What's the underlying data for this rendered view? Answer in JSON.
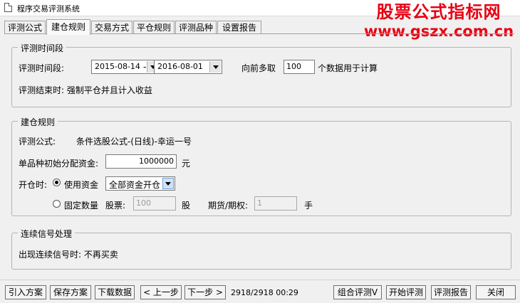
{
  "window": {
    "title": "程序交易评测系统"
  },
  "watermark": {
    "line1": "股票公式指标网",
    "line2": "www.gszx.com.cn"
  },
  "tabs": [
    {
      "label": "评测公式"
    },
    {
      "label": "建仓规则"
    },
    {
      "label": "交易方式"
    },
    {
      "label": "平仓规则"
    },
    {
      "label": "评测品种"
    },
    {
      "label": "设置报告"
    }
  ],
  "period": {
    "title": "评测时间段",
    "label": "评测时间段:",
    "start": "2015-08-14",
    "dash": "-",
    "end": "2016-08-01",
    "lookback_prefix": "向前多取",
    "lookback_value": "100",
    "lookback_suffix": "个数据用于计算",
    "end_rule": "评测结束时: 强制平仓并且计入收益"
  },
  "build": {
    "title": "建仓规则",
    "formula_label": "评测公式:",
    "formula_value": "条件选股公式-(日线)-幸运一号",
    "capital_label": "单品种初始分配资金:",
    "capital_value": "1000000",
    "capital_unit": "元",
    "open_label": "开仓时:",
    "use_capital_label": "使用资金",
    "use_capital_option": "全部资金开仓",
    "fixed_qty_label": "固定数量",
    "stock_label": "股票:",
    "stock_value": "100",
    "stock_unit": "股",
    "futures_label": "期货/期权:",
    "futures_value": "1",
    "futures_unit": "手"
  },
  "signal": {
    "title": "连续信号处理",
    "text": "出现连续信号时: 不再买卖"
  },
  "bottom": {
    "import": "引入方案",
    "save": "保存方案",
    "download": "下载数据",
    "prev": "< 上一步",
    "next": "下一步 >",
    "status": "2918/2918 00:29",
    "combo": "组合评测V",
    "start": "开始评测",
    "report": "评测报告",
    "close": "关闭"
  },
  "colors": {
    "watermark": "#e60012"
  }
}
